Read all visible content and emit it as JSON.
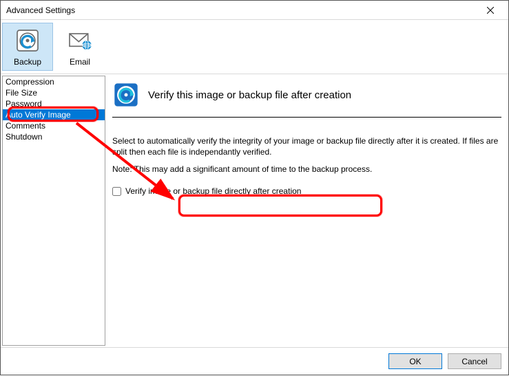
{
  "window": {
    "title": "Advanced Settings"
  },
  "toolbar": {
    "items": [
      {
        "id": "backup",
        "label": "Backup",
        "selected": true
      },
      {
        "id": "email",
        "label": "Email",
        "selected": false
      }
    ]
  },
  "sidebar": {
    "items": [
      {
        "label": "Compression",
        "selected": false
      },
      {
        "label": "File Size",
        "selected": false
      },
      {
        "label": "Password",
        "selected": false
      },
      {
        "label": "Auto Verify Image",
        "selected": true
      },
      {
        "label": "Comments",
        "selected": false
      },
      {
        "label": "Shutdown",
        "selected": false
      }
    ]
  },
  "content": {
    "title": "Verify this image or backup file after creation",
    "description": "Select to automatically verify the integrity of your image or backup file directly after it is created. If files are split then each file is independantly verified.",
    "note": "Note: This may add a significant amount of time to the backup process.",
    "checkbox_label": "Verify image or backup file directly after creation",
    "checkbox_checked": false
  },
  "footer": {
    "ok_label": "OK",
    "cancel_label": "Cancel"
  }
}
